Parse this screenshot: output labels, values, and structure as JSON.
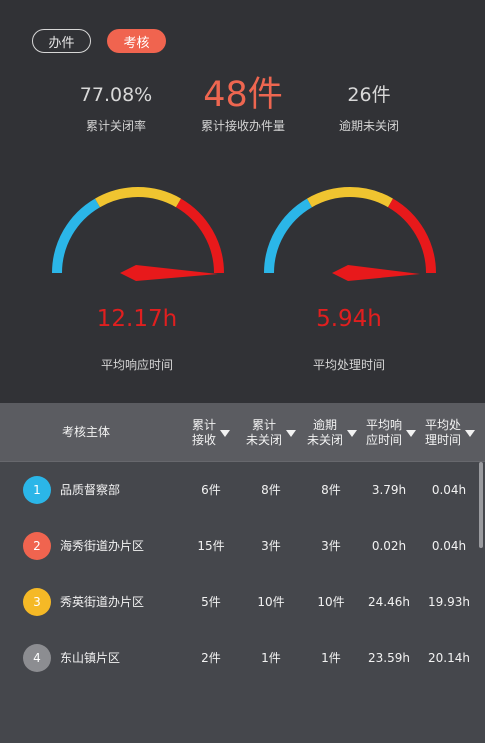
{
  "tabs": [
    {
      "label": "办件",
      "active": false
    },
    {
      "label": "考核",
      "active": true
    }
  ],
  "stats": [
    {
      "value": "77.08%",
      "label": "累计关闭率"
    },
    {
      "value": "48件",
      "label": "累计接收办件量"
    },
    {
      "value": "26件",
      "label": "逾期未关闭"
    }
  ],
  "gauges": [
    {
      "value": "12.17h",
      "label": "平均响应时间"
    },
    {
      "value": "5.94h",
      "label": "平均处理时间"
    }
  ],
  "table": {
    "headers": [
      "考核主体",
      "累计\n接收",
      "累计\n未关闭",
      "逾期\n未关闭",
      "平均响\n应时间",
      "平均处\n理时间"
    ],
    "rows": [
      {
        "rank": "1",
        "badge_color": "#2bb6e8",
        "name": "品质督察部",
        "received": "6件",
        "open": "8件",
        "overdue": "8件",
        "resp": "3.79h",
        "proc": "0.04h"
      },
      {
        "rank": "2",
        "badge_color": "#f0644f",
        "name": "海秀街道办片区",
        "received": "15件",
        "open": "3件",
        "overdue": "3件",
        "resp": "0.02h",
        "proc": "0.04h"
      },
      {
        "rank": "3",
        "badge_color": "#f5b926",
        "name": "秀英街道办片区",
        "received": "5件",
        "open": "10件",
        "overdue": "10件",
        "resp": "24.46h",
        "proc": "19.93h"
      },
      {
        "rank": "4",
        "badge_color": "#8c8d91",
        "name": "东山镇片区",
        "received": "2件",
        "open": "1件",
        "overdue": "1件",
        "resp": "23.59h",
        "proc": "20.14h"
      }
    ]
  },
  "colors": {
    "accent": "#f0644f",
    "gauge_blue": "#2bb6e8",
    "gauge_yellow": "#f0c430",
    "gauge_red": "#e8191b"
  }
}
